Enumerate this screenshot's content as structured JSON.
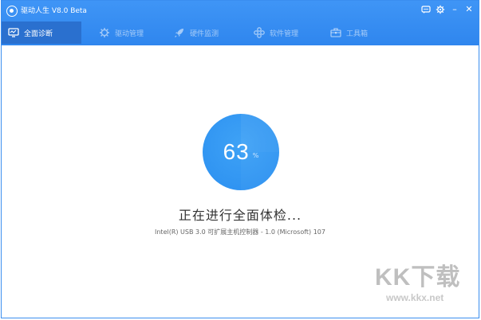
{
  "window": {
    "title": "驱动人生 V8.0 Beta",
    "accent_color": "#2f86ee",
    "active_tab_color": "#2a70cf"
  },
  "title_controls": {
    "icons": [
      "message-icon",
      "gear-icon",
      "minimize-icon",
      "close-icon"
    ],
    "minimize_glyph": "–",
    "close_glyph": "✕"
  },
  "tabs": [
    {
      "label": "全面诊断",
      "icon": "monitor-icon",
      "active": true
    },
    {
      "label": "驱动管理",
      "icon": "gear-icon",
      "active": false
    },
    {
      "label": "硬件监测",
      "icon": "rocket-icon",
      "active": false
    },
    {
      "label": "软件管理",
      "icon": "apps-icon",
      "active": false
    },
    {
      "label": "工具箱",
      "icon": "toolbox-icon",
      "active": false
    }
  ],
  "scan": {
    "progress": 63,
    "progress_unit": "%",
    "status": "正在进行全面体检...",
    "detail": "Intel(R) USB 3.0 可扩展主机控制器 - 1.0 (Microsoft) 107",
    "circle_color": "#2b8ff0"
  },
  "watermark": {
    "brand": "KK下载",
    "url": "www.kkx.net"
  }
}
